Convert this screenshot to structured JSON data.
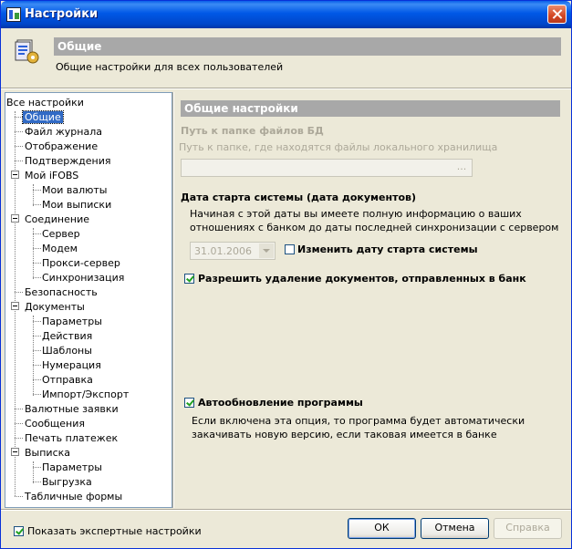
{
  "window": {
    "title": "Настройки"
  },
  "header": {
    "title": "Общие",
    "subtitle": "Общие настройки для всех пользователей"
  },
  "tree": {
    "root": "Все настройки",
    "items": [
      {
        "label": "Общие"
      },
      {
        "label": "Файл журнала"
      },
      {
        "label": "Отображение"
      },
      {
        "label": "Подтверждения"
      },
      {
        "label": "Мой iFOBS"
      },
      {
        "label": "Мои валюты"
      },
      {
        "label": "Мои выписки"
      },
      {
        "label": "Соединение"
      },
      {
        "label": "Сервер"
      },
      {
        "label": "Модем"
      },
      {
        "label": "Прокси-сервер"
      },
      {
        "label": "Синхронизация"
      },
      {
        "label": "Безопасность"
      },
      {
        "label": "Документы"
      },
      {
        "label": "Параметры"
      },
      {
        "label": "Действия"
      },
      {
        "label": "Шаблоны"
      },
      {
        "label": "Нумерация"
      },
      {
        "label": "Отправка"
      },
      {
        "label": "Импорт/Экспорт"
      },
      {
        "label": "Валютные заявки"
      },
      {
        "label": "Сообщения"
      },
      {
        "label": "Печать платежек"
      },
      {
        "label": "Выписка"
      },
      {
        "label": "Параметры"
      },
      {
        "label": "Выгрузка"
      },
      {
        "label": "Табличные формы"
      }
    ]
  },
  "section": {
    "title": "Общие настройки"
  },
  "db_path": {
    "label": "Путь к папке файлов БД",
    "hint": "Путь к папке, где находятся файлы локального хранилища",
    "value": "",
    "browse_label": "..."
  },
  "start_date": {
    "label": "Дата старта системы (дата документов)",
    "desc_line1": "Начиная с этой даты вы имеете полную информацию о ваших",
    "desc_line2": "отношениях с банком до даты последней синхронизации с сервером",
    "value": "31.01.2006",
    "change_label": "Изменить дату старта системы",
    "change_checked": false
  },
  "allow_delete": {
    "label": "Разрешить удаление документов, отправленных в банк",
    "checked": true
  },
  "auto_update": {
    "label": "Автообновление программы",
    "checked": true,
    "desc_line1": "Если включена эта опция, то программа будет автоматически",
    "desc_line2": "закачивать новую версию, если таковая имеется в банке"
  },
  "footer": {
    "expert_label": "Показать экспертные настройки",
    "expert_checked": true,
    "ok": "ОК",
    "cancel": "Отмена",
    "help": "Справка"
  },
  "icons": {
    "title": "app-icon",
    "header": "settings-icon",
    "close": "close-icon",
    "expander": "minus-icon"
  }
}
